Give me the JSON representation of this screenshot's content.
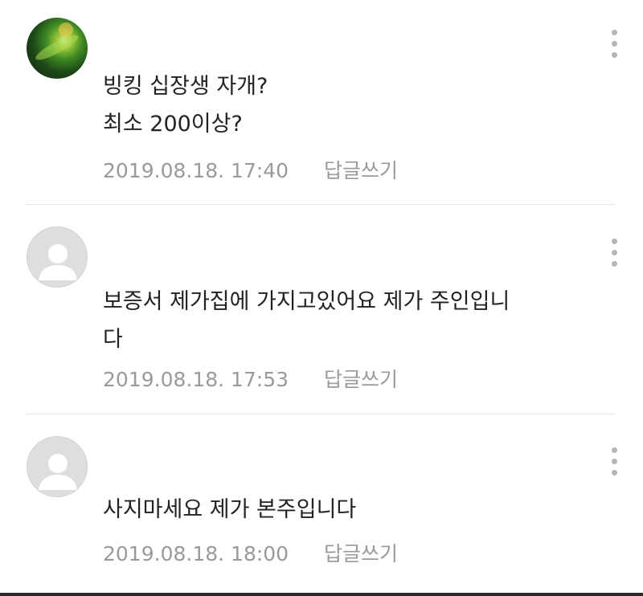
{
  "comments": [
    {
      "avatar": "photo-avatar",
      "lines": [
        "빙킹 십장생 자개?",
        "최소 200이상?"
      ],
      "date": "2019.08.18. 17:40",
      "reply_label": "답글쓰기"
    },
    {
      "avatar": "default-user-avatar",
      "lines": [
        "보증서 제가집에 가지고있어요 제가 주인입니",
        "다"
      ],
      "date": "2019.08.18. 17:53",
      "reply_label": "답글쓰기"
    },
    {
      "avatar": "default-user-avatar",
      "lines": [
        "사지마세요 제가 본주입니다"
      ],
      "date": "2019.08.18. 18:00",
      "reply_label": "답글쓰기"
    }
  ],
  "icons": {
    "more": "more-vertical-icon"
  },
  "colors": {
    "text": "#222222",
    "meta": "#9a9a9a",
    "divider": "#e4e4e4"
  }
}
